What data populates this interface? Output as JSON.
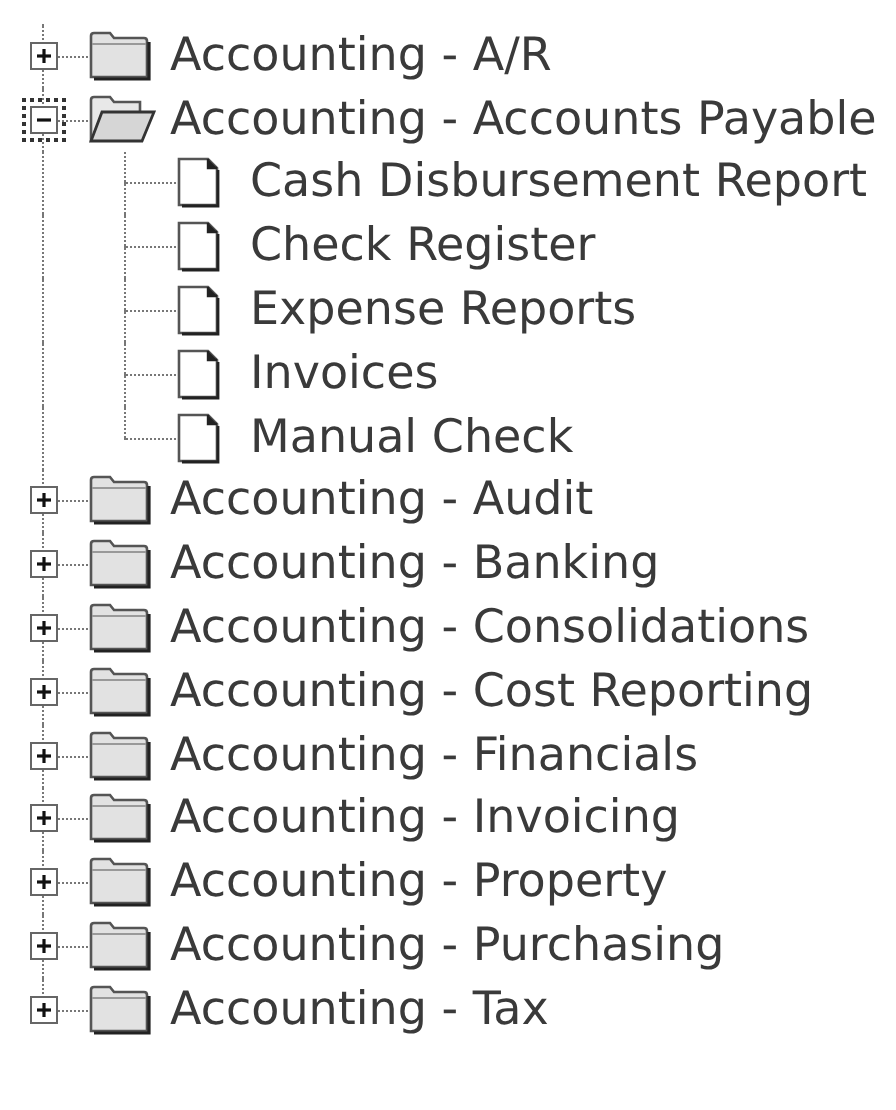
{
  "tree": {
    "items": [
      {
        "label": "Accounting - A/R",
        "expanded": false,
        "focused": false
      },
      {
        "label": "Accounting - Accounts Payable",
        "expanded": true,
        "focused": true,
        "children": [
          {
            "label": "Cash Disbursement Report"
          },
          {
            "label": "Check Register"
          },
          {
            "label": "Expense Reports"
          },
          {
            "label": "Invoices"
          },
          {
            "label": "Manual Check"
          }
        ]
      },
      {
        "label": "Accounting - Audit",
        "expanded": false,
        "focused": false
      },
      {
        "label": "Accounting - Banking",
        "expanded": false,
        "focused": false
      },
      {
        "label": "Accounting - Consolidations",
        "expanded": false,
        "focused": false
      },
      {
        "label": "Accounting - Cost Reporting",
        "expanded": false,
        "focused": false
      },
      {
        "label": "Accounting - Financials",
        "expanded": false,
        "focused": false
      },
      {
        "label": "Accounting - Invoicing",
        "expanded": false,
        "focused": false
      },
      {
        "label": "Accounting - Property",
        "expanded": false,
        "focused": false
      },
      {
        "label": "Accounting - Purchasing",
        "expanded": false,
        "focused": false
      },
      {
        "label": "Accounting - Tax",
        "expanded": false,
        "focused": false
      }
    ]
  }
}
